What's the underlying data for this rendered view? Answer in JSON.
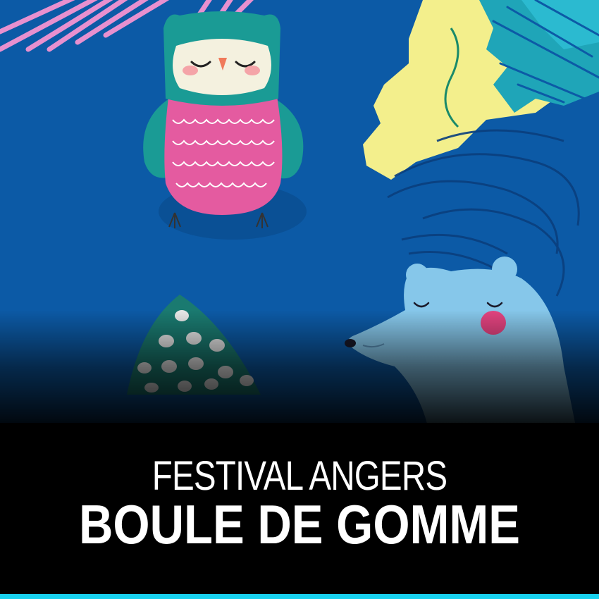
{
  "event": {
    "subtitle": "FESTIVAL ANGERS",
    "title": "BOULE DE GOMME"
  },
  "colors": {
    "background": "#0c5aa6",
    "caption_bg": "#000000",
    "text": "#ffffff",
    "accent_bar": "#19d3f0",
    "owl_teal": "#1a9b95",
    "owl_pink": "#e45ba0",
    "bear_blue": "#86c7ea",
    "leaf_yellow": "#f3ef8c",
    "palm_pink": "#e890cf"
  },
  "icons": {
    "owl": "owl-illustration",
    "bear": "bear-illustration",
    "tree": "tree-illustration",
    "leaves": "leaf-illustration"
  }
}
